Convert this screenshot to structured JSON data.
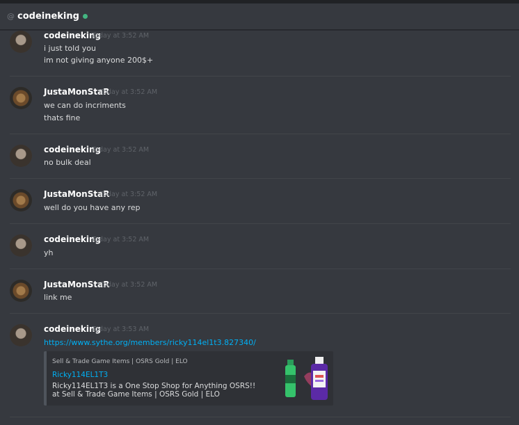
{
  "header": {
    "at_symbol": "@",
    "channel_name": "codeineking"
  },
  "messages": [
    {
      "author": "codeineking",
      "timestamp": "Today at 3:52 AM",
      "lines": [
        "i just told you",
        "im not giving anyone 200$+"
      ]
    },
    {
      "author": "JustaMonStaR",
      "timestamp": "Today at 3:52 AM",
      "lines": [
        "we can do incriments",
        "thats fine"
      ]
    },
    {
      "author": "codeineking",
      "timestamp": "Today at 3:52 AM",
      "lines": [
        "no bulk deal"
      ]
    },
    {
      "author": "JustaMonStaR",
      "timestamp": "Today at 3:52 AM",
      "lines": [
        "well do you have any rep"
      ]
    },
    {
      "author": "codeineking",
      "timestamp": "Today at 3:52 AM",
      "lines": [
        "yh"
      ]
    },
    {
      "author": "JustaMonStaR",
      "timestamp": "Today at 3:52 AM",
      "lines": [
        "link me"
      ]
    },
    {
      "author": "codeineking",
      "timestamp": "Today at 3:53 AM",
      "link": "https://www.sythe.org/members/ricky114el1t3.827340/",
      "embed": {
        "provider": "Sell & Trade Game Items | OSRS Gold | ELO",
        "title": "Ricky114EL1T3",
        "description": "Ricky114EL1T3 is a One Stop Shop for Anything OSRS!! at Sell & Trade Game Items | OSRS Gold | ELO"
      }
    }
  ],
  "icons": {
    "online": "online-status-dot",
    "thumb": "soda-and-lean-bottles-icon"
  },
  "colors": {
    "background": "#36393f",
    "link": "#00b0f4",
    "online": "#43b581"
  }
}
